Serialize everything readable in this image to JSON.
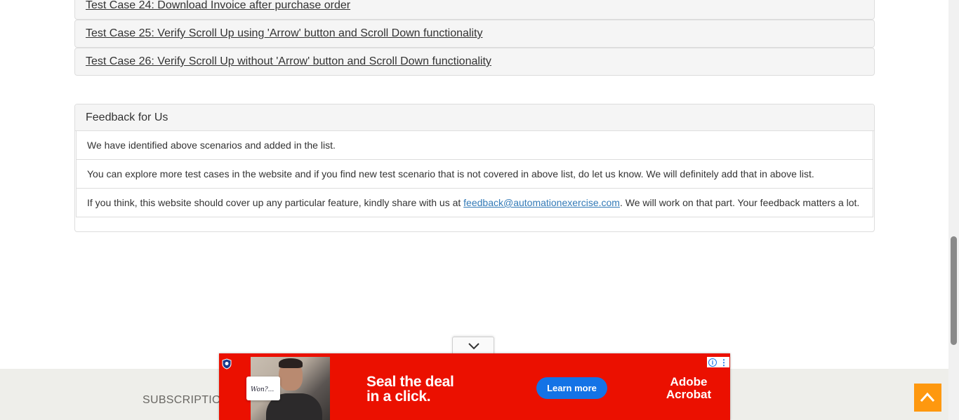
{
  "test_cases": [
    {
      "label": "Test Case 24: Download Invoice after purchase order"
    },
    {
      "label": "Test Case 25: Verify Scroll Up using 'Arrow' button and Scroll Down functionality"
    },
    {
      "label": "Test Case 26: Verify Scroll Up without 'Arrow' button and Scroll Down functionality"
    }
  ],
  "feedback": {
    "title": "Feedback for Us",
    "line1": "We have identified above scenarios and added in the list.",
    "line2": "You can explore more test cases in the website and if you find new test scenario that is not covered in above list, do let us know. We will definitely add that in above list.",
    "line3_prefix": "If you think, this website should cover up any particular feature, kindly share with us at ",
    "line3_email": "feedback@automationexercise.com",
    "line3_suffix": ". We will work on that part. Your feedback matters a lot."
  },
  "footer": {
    "subscription": "SUBSCRIPTION"
  },
  "ad": {
    "headline_1": "Seal the deal",
    "headline_2": "in a click.",
    "button": "Learn more",
    "brand_1": "Adobe",
    "brand_2": "Acrobat",
    "card_text": "Won?...",
    "colors": {
      "background": "#eb1000",
      "button": "#1473e6"
    }
  },
  "icons": {
    "collapse": "chevron-down-icon",
    "scroll_top": "chevron-up-icon",
    "ad_info": "info-icon",
    "ad_menu": "more-vertical-icon"
  },
  "colors": {
    "accent": "#fe980f",
    "link": "#337ab7",
    "panel_bg": "#f5f5f5",
    "footer_bg": "#eeeeea"
  }
}
